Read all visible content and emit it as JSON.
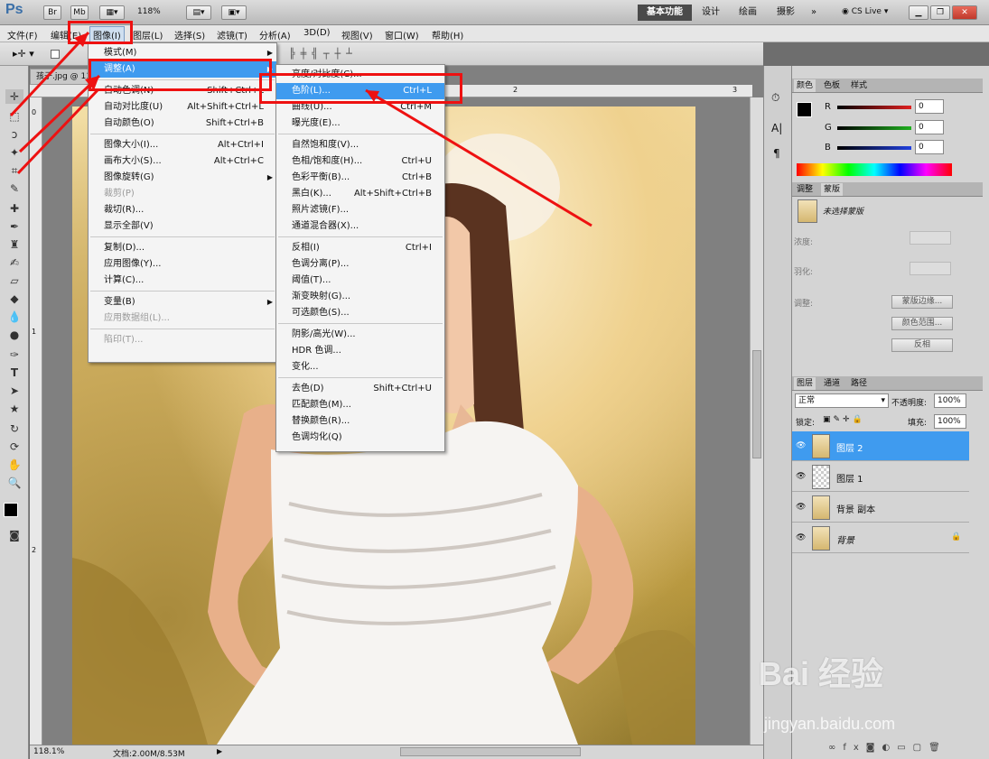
{
  "app": {
    "logo": "Ps",
    "br": "Br",
    "mb": "Mb",
    "zoom": "118%",
    "workspaces": [
      "基本功能",
      "设计",
      "绘画",
      "摄影"
    ],
    "more": "»",
    "cslive": "CS Live"
  },
  "menubar": [
    "文件(F)",
    "编辑(E)",
    "图像(I)",
    "图层(L)",
    "选择(S)",
    "滤镜(T)",
    "分析(A)",
    "3D(D)",
    "视图(V)",
    "窗口(W)",
    "帮助(H)"
  ],
  "doc": {
    "tab": "孩子.jpg @ 118%",
    "zoom_status": "118.1%",
    "doc_size": "文档:2.00M/8.53M",
    "ruler_marks": [
      "1",
      "2",
      "3"
    ],
    "vruler_marks": [
      "0",
      "1",
      "2"
    ]
  },
  "image_menu": [
    {
      "label": "模式(M)",
      "sub": true
    },
    {
      "label": "调整(A)",
      "sub": true,
      "highlight": true
    },
    {
      "label": "自动色调(N)",
      "shortcut": "Shift+Ctrl+L"
    },
    {
      "label": "自动对比度(U)",
      "shortcut": "Alt+Shift+Ctrl+L"
    },
    {
      "label": "自动颜色(O)",
      "shortcut": "Shift+Ctrl+B"
    },
    {
      "label": "图像大小(I)...",
      "shortcut": "Alt+Ctrl+I"
    },
    {
      "label": "画布大小(S)...",
      "shortcut": "Alt+Ctrl+C"
    },
    {
      "label": "图像旋转(G)",
      "sub": true
    },
    {
      "label": "裁剪(P)",
      "disabled": true
    },
    {
      "label": "裁切(R)..."
    },
    {
      "label": "显示全部(V)"
    },
    {
      "label": "复制(D)..."
    },
    {
      "label": "应用图像(Y)..."
    },
    {
      "label": "计算(C)..."
    },
    {
      "label": "变量(B)",
      "sub": true
    },
    {
      "label": "应用数据组(L)...",
      "disabled": true
    },
    {
      "label": "陷印(T)...",
      "disabled": true
    }
  ],
  "adjust_menu": [
    {
      "label": "亮度/对比度(C)..."
    },
    {
      "label": "色阶(L)...",
      "shortcut": "Ctrl+L",
      "highlight": true
    },
    {
      "label": "曲线(U)...",
      "shortcut": "Ctrl+M"
    },
    {
      "label": "曝光度(E)..."
    },
    {
      "label": "自然饱和度(V)..."
    },
    {
      "label": "色相/饱和度(H)...",
      "shortcut": "Ctrl+U"
    },
    {
      "label": "色彩平衡(B)...",
      "shortcut": "Ctrl+B"
    },
    {
      "label": "黑白(K)...",
      "shortcut": "Alt+Shift+Ctrl+B"
    },
    {
      "label": "照片滤镜(F)..."
    },
    {
      "label": "通道混合器(X)..."
    },
    {
      "label": "反相(I)",
      "shortcut": "Ctrl+I"
    },
    {
      "label": "色调分离(P)..."
    },
    {
      "label": "阈值(T)..."
    },
    {
      "label": "渐变映射(G)..."
    },
    {
      "label": "可选颜色(S)..."
    },
    {
      "label": "阴影/高光(W)..."
    },
    {
      "label": "HDR 色调..."
    },
    {
      "label": "变化..."
    },
    {
      "label": "去色(D)",
      "shortcut": "Shift+Ctrl+U"
    },
    {
      "label": "匹配颜色(M)..."
    },
    {
      "label": "替换颜色(R)..."
    },
    {
      "label": "色调均化(Q)"
    }
  ],
  "color_panel": {
    "tabs": [
      "颜色",
      "色板",
      "样式"
    ],
    "channels": [
      {
        "name": "R",
        "value": "0",
        "color": "#e02020"
      },
      {
        "name": "G",
        "value": "0",
        "color": "#20b020"
      },
      {
        "name": "B",
        "value": "0",
        "color": "#2040e0"
      }
    ]
  },
  "masks_panel": {
    "tabs": [
      "调整",
      "蒙版"
    ],
    "status": "未选择蒙版",
    "density": "浓度:",
    "feather": "羽化:",
    "refine": "调整:",
    "buttons": [
      "蒙版边缘...",
      "颜色范围...",
      "反相"
    ]
  },
  "layers_panel": {
    "tabs": [
      "图层",
      "通道",
      "路径"
    ],
    "blend": "正常",
    "opacity_label": "不透明度:",
    "opacity": "100%",
    "lock_label": "锁定:",
    "fill_label": "填充:",
    "fill": "100%",
    "layers": [
      {
        "name": "图层 2",
        "selected": true
      },
      {
        "name": "图层 1"
      },
      {
        "name": "背景 副本"
      },
      {
        "name": "背景",
        "locked": true
      }
    ]
  },
  "watermark": {
    "text": "Bai 经验",
    "url": "jingyan.baidu.com"
  }
}
